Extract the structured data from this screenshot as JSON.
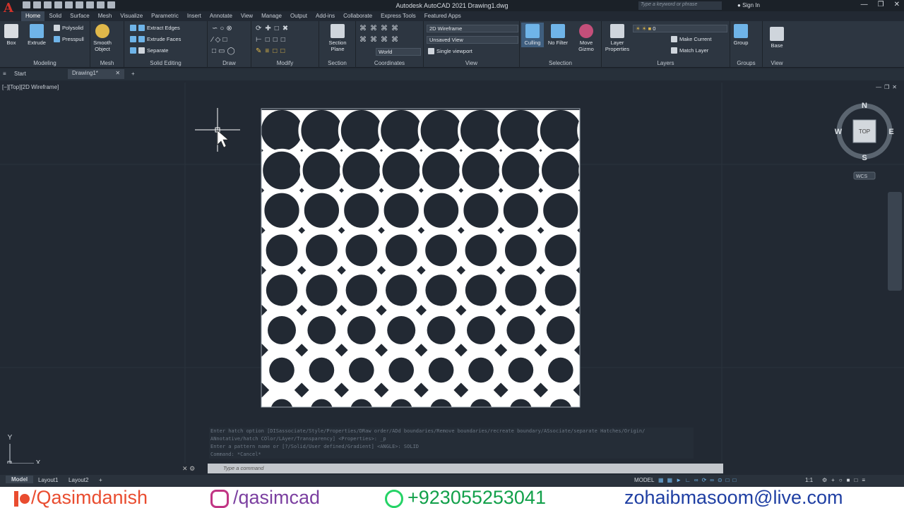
{
  "titlebar": {
    "title": "Autodesk AutoCAD 2021   Drawing1.dwg",
    "search_placeholder": "Type a keyword or phrase",
    "signin": "Sign In"
  },
  "menu": [
    "Home",
    "Solid",
    "Surface",
    "Mesh",
    "Visualize",
    "Parametric",
    "Insert",
    "Annotate",
    "View",
    "Manage",
    "Output",
    "Add-ins",
    "Collaborate",
    "Express Tools",
    "Featured Apps"
  ],
  "ribbon": {
    "modeling": {
      "label": "Modeling",
      "box": "Box",
      "extrude": "Extrude",
      "polysolid": "Polysolid",
      "presspull": "Presspull"
    },
    "mesh": {
      "label": "Mesh",
      "smooth": "Smooth Object"
    },
    "solid_editing": {
      "label": "Solid Editing",
      "extract": "Extract Edges",
      "extrude_faces": "Extrude Faces",
      "separate": "Separate"
    },
    "draw": {
      "label": "Draw"
    },
    "modify": {
      "label": "Modify"
    },
    "section": {
      "label": "Section",
      "plane": "Section Plane"
    },
    "coordinates": {
      "label": "Coordinates",
      "world": "World"
    },
    "view": {
      "label": "View",
      "visual_style": "2D Wireframe",
      "named_view": "Unsaved View",
      "viewport": "Single viewport"
    },
    "selection": {
      "label": "Selection",
      "culling": "Culling",
      "no_filter": "No Filter",
      "move_gizmo": "Move Gizmo"
    },
    "layers": {
      "label": "Layers",
      "layer_properties": "Layer Properties",
      "layer_value": "0",
      "make_current": "Make Current",
      "match_layer": "Match Layer"
    },
    "groups": {
      "label": "Groups",
      "group": "Group"
    },
    "view2": {
      "label": "View",
      "base": "Base"
    }
  },
  "filetabs": {
    "start": "Start",
    "drawing": "Drawing1*"
  },
  "viewport": {
    "label": "[−][Top][2D Wireframe]",
    "compass": {
      "n": "N",
      "s": "S",
      "e": "E",
      "w": "W",
      "face": "TOP",
      "wcs": "WCS"
    },
    "ucs": {
      "x": "X",
      "y": "Y"
    }
  },
  "command": {
    "history": [
      "Enter hatch option [DISassociate/Style/Properties/DRaw order/ADd boundaries/Remove boundaries/recreate boundary/ASsociate/separate Hatches/Origin/",
      "ANnotative/hatch COlor/LAyer/Transparency] <Properties>: _p",
      "Enter a pattern name or [?/Solid/User defined/Gradient] <ANGLE>: SOLID",
      "Command: *Cancel*"
    ],
    "placeholder": "Type a command"
  },
  "status": {
    "model_tab": "Model",
    "layout1": "Layout1",
    "layout2": "Layout2",
    "model_label": "MODEL",
    "scale": "1:1"
  },
  "footer": {
    "patreon": "/Qasimdanish",
    "instagram": "/qasimcad",
    "whatsapp": "+923055253041",
    "email": "zohaibmasoom@live.com"
  }
}
